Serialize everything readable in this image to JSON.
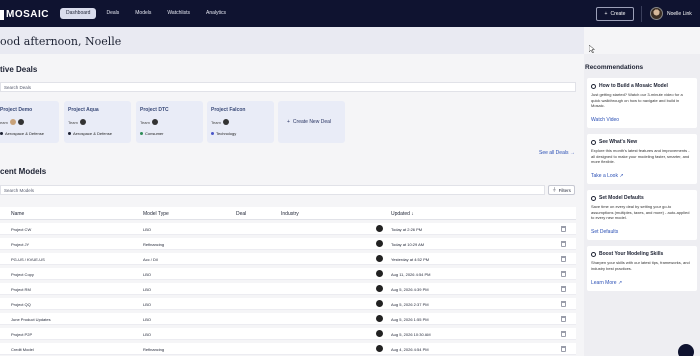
{
  "nav": {
    "logo": "MOSAIC",
    "tabs": [
      "Dashboard",
      "Deals",
      "Models",
      "Watchlists",
      "Analytics"
    ],
    "create_label": "Create",
    "user_name": "Noelle Link"
  },
  "greeting": "ood afternoon, Noelle",
  "active_deals": {
    "title": "tive Deals",
    "search_placeholder": "Search Deals",
    "cards": [
      {
        "name": "Project Demo",
        "team_label": "eam",
        "industry": "Aerospace & Defense",
        "industry_color": "#1d2233"
      },
      {
        "name": "Project Aqua",
        "team_label": "Team",
        "industry": "Aerospace & Defense",
        "industry_color": "#1d2233"
      },
      {
        "name": "Project DTC",
        "team_label": "Team",
        "industry": "Consumer",
        "industry_color": "#2e8b57"
      },
      {
        "name": "Project Falcon",
        "team_label": "Team",
        "industry": "Technology",
        "industry_color": "#4b57c8"
      }
    ],
    "new_deal_label": "Create New Deal",
    "see_all_label": "See all Deals →"
  },
  "recent_models": {
    "title": "cent Models",
    "search_placeholder": "Search Models",
    "filters_label": "Filters",
    "columns": [
      "Name",
      "Model Type",
      "Deal",
      "Industry",
      "Updated ↓"
    ],
    "rows": [
      {
        "name": "Project CW",
        "type": "LBO",
        "updated": "Today at 2:26 PM"
      },
      {
        "name": "Project JY",
        "type": "Refinancing",
        "updated": "Today at 10:29 AM"
      },
      {
        "name": "PG-US / KVUE-US",
        "type": "Acc / Dil",
        "updated": "Yesterday at 4:52 PM"
      },
      {
        "name": "Project Copy",
        "type": "LBO",
        "updated": "Aug 11, 2026 4:54 PM"
      },
      {
        "name": "Project RM",
        "type": "LBO",
        "updated": "Aug 5, 2026 4:39 PM"
      },
      {
        "name": "Project QQ",
        "type": "LBO",
        "updated": "Aug 5, 2026 2:37 PM"
      },
      {
        "name": "June Product Updates",
        "type": "LBO",
        "updated": "Aug 5, 2026 1:55 PM"
      },
      {
        "name": "Project P2P",
        "type": "LBO",
        "updated": "Aug 5, 2026 10:30 AM"
      },
      {
        "name": "Credit Model",
        "type": "Refinancing",
        "updated": "Aug 4, 2026 4:54 PM"
      }
    ]
  },
  "sidebar": {
    "title": "Recommendations",
    "cards": [
      {
        "title": "How to Build a Mosaic Model",
        "body": "Just getting started? Watch our 3-minute video for a quick walkthrough on how to navigate and build in Mosaic.",
        "link": "Watch Video"
      },
      {
        "title": "See What's New",
        "body": "Explore this month's latest features and improvements - all designed to make your modeling faster, smarter, and more flexible.",
        "link": "Take a Look ↗"
      },
      {
        "title": "Set Model Defaults",
        "body": "Save time on every deal by setting your go-to assumptions (multiples, taxes, and more) - auto-applied to every new model.",
        "link": "Set Defaults"
      },
      {
        "title": "Boost Your Modeling Skills",
        "body": "Sharpen your skills with our latest tips, frameworks, and industry best practices.",
        "link": "Learn More ↗"
      }
    ]
  },
  "colors": {
    "nav_bg": "#0f1330",
    "accent_link": "#2a4fb5",
    "card_bg": "#e9ecf7"
  }
}
